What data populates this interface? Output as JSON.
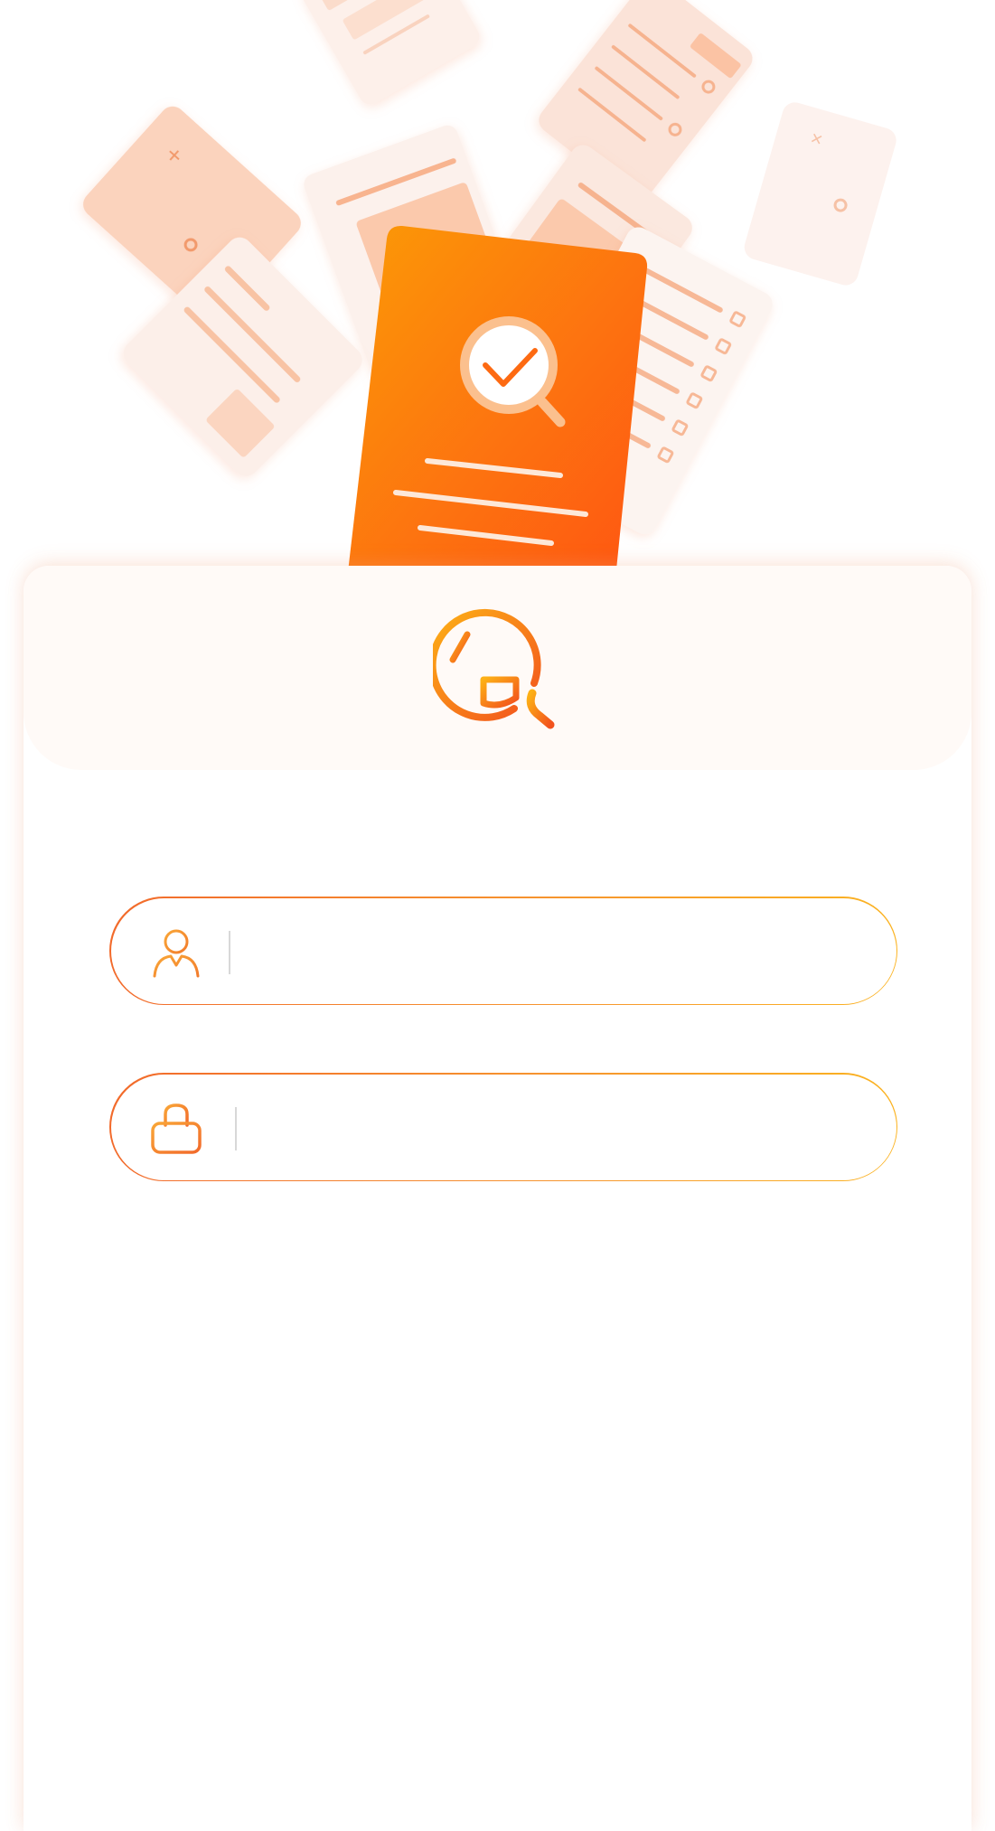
{
  "brand": {
    "logo_icon": "xin-magnifier-logo-icon",
    "accent_colors": [
      "#f26a2b",
      "#f6942f",
      "#fbb321"
    ],
    "panel_background": "#fffaf7"
  },
  "login": {
    "username": {
      "icon": "user-icon",
      "value": "",
      "placeholder": ""
    },
    "password": {
      "icon": "lock-icon",
      "value": "",
      "placeholder": ""
    }
  }
}
